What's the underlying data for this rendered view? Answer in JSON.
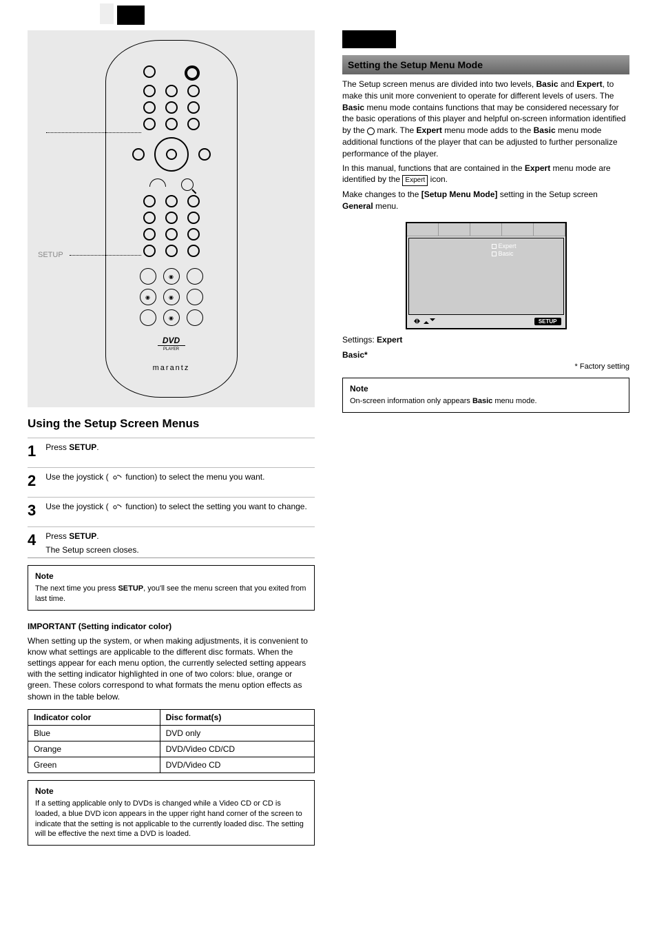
{
  "left": {
    "section_label": "",
    "remote": {
      "dvd_logo": "DVD",
      "sub_logo": "PLAYER",
      "brand": "marantz",
      "setup_label": "SETUP"
    },
    "heading": "Using the Setup Screen Menus",
    "steps": [
      {
        "n": "1",
        "text_a": "Press ",
        "btn": "SETUP",
        "text_b": "."
      },
      {
        "n": "2",
        "text_a": "Use the joystick (",
        "sym": "⇆",
        "text_b": " function) to select the menu you want."
      },
      {
        "n": "3",
        "text_a": "Use the joystick (",
        "sym": "⇅",
        "text_b": " function) to select the setting you want to change."
      },
      {
        "n": "4",
        "text_a": "Press ",
        "btn": "SETUP",
        "text_b": ".",
        "sub": "The Setup screen closes."
      }
    ],
    "note1": {
      "title": "Note",
      "body_a": "The next time you press ",
      "btn": "SETUP",
      "body_b": ", you'll see the menu screen that you exited from last time."
    },
    "color_heading": "IMPORTANT (Setting indicator color)",
    "color_body": "When setting up the system, or when making adjustments, it is convenient to know what settings are applicable to the different disc formats. When the settings appear for each menu option, the currently selected setting appears with the setting indicator highlighted in one of two colors: blue, orange or green. These colors correspond to what formats the menu option effects as shown in the table below.",
    "table": {
      "head": [
        "Indicator color",
        "Disc format(s)"
      ],
      "rows": [
        [
          "Blue",
          "DVD only"
        ],
        [
          "Orange",
          "DVD/Video CD/CD"
        ],
        [
          "Green",
          "DVD/Video CD"
        ]
      ]
    },
    "note2": {
      "title": "Note",
      "body": "If a setting applicable only to DVDs is changed while a Video CD or CD is loaded, a blue DVD icon appears in the upper right hand corner of the screen to indicate that the setting is not applicable to the currently loaded disc. The setting will be effective the next time a DVD is loaded."
    }
  },
  "right": {
    "heading": "Setting the Setup Menu Mode",
    "p1a": "The Setup screen menus are divided into two levels, ",
    "bold1": "Basic",
    "p1b": " and ",
    "bold2": "Expert",
    "p1c": ", to make this unit more convenient to operate for different levels of users. The ",
    "bold3": "Basic",
    "p1d": " menu mode contains functions that may be considered necessary for the basic operations of this player and helpful on-screen information identified by the ",
    "p1e": " mark. The ",
    "bold4": "Expert",
    "p1f": " menu mode adds to the ",
    "bold5": "Basic",
    "p1g": " menu mode additional functions of the player that can be adjusted to further personalize performance of the player.",
    "p2a": "In this manual, functions that are contained in the ",
    "bold6": "Expert",
    "p2b": " menu mode are identified by the ",
    "p2c": " icon.",
    "p3a": "Make changes to the ",
    "bold7": "[Setup Menu Mode]",
    "p3b": " setting in the Setup screen ",
    "bold8": "General",
    "p3c": " menu.",
    "menu": {
      "expert": "Expert",
      "basic": "Basic",
      "setup": "SETUP"
    },
    "settings_label": "Settings:",
    "settings_expert": "Expert",
    "settings_basic": "Basic*",
    "factory": "* Factory setting",
    "note": {
      "title": "Note",
      "body_a": "On-screen information only appears ",
      "bold": "Basic",
      "body_b": " menu mode."
    },
    "expert_badge": "Expert"
  }
}
